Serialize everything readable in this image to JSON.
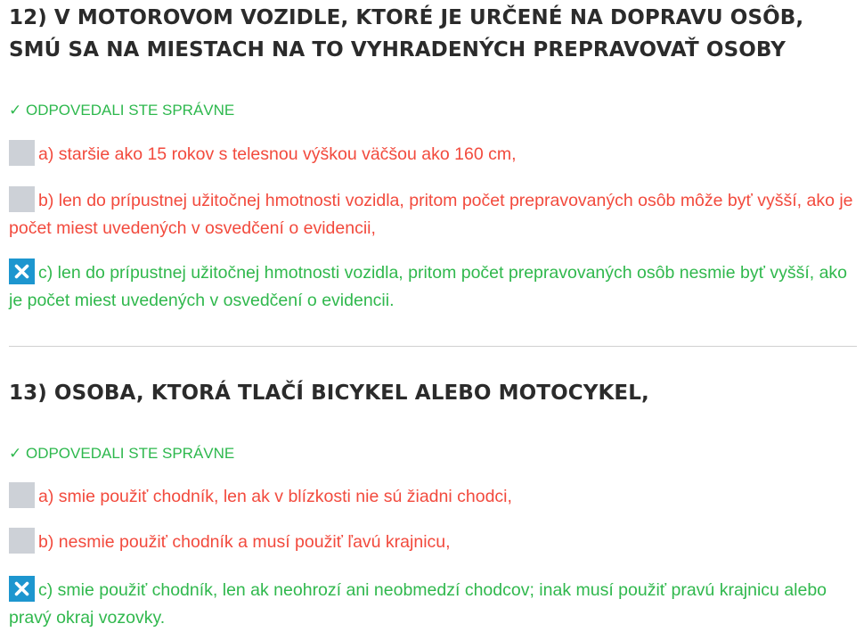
{
  "questions": [
    {
      "title": "12) V MOTOROVOM VOZIDLE, KTORÉ JE URČENÉ NA DOPRAVU OSÔB, SMÚ SA NA MIESTACH NA TO VYHRADENÝCH PREPRAVOVAŤ OSOBY",
      "result": "✓ ODPOVEDALI STE SPRÁVNE",
      "answers": [
        {
          "text": "a) staršie ako 15 rokov s telesnou výškou väčšou ako 160 cm,",
          "checked": false,
          "correct": false
        },
        {
          "text": "b) len do prípustnej užitočnej hmotnosti vozidla, pritom počet prepravovaných osôb môže byť vyšší, ako je počet miest uvedených v osvedčení o evidencii,",
          "checked": false,
          "correct": false
        },
        {
          "text": "c) len do prípustnej užitočnej hmotnosti vozidla, pritom počet prepravovaných osôb nesmie byť vyšší, ako je počet miest uvedených v osvedčení o evidencii.",
          "checked": true,
          "correct": true
        }
      ]
    },
    {
      "title": "13) OSOBA, KTORÁ TLAČÍ BICYKEL ALEBO MOTOCYKEL,",
      "result": "✓ ODPOVEDALI STE SPRÁVNE",
      "answers": [
        {
          "text": "a) smie použiť chodník, len ak v blízkosti nie sú žiadni chodci,",
          "checked": false,
          "correct": false
        },
        {
          "text": "b) nesmie použiť chodník a musí použiť ľavú krajnicu,",
          "checked": false,
          "correct": false
        },
        {
          "text": "c) smie použiť chodník, len ak neohrozí ani neobmedzí chodcov; inak musí použiť pravú krajnicu alebo pravý okraj vozovky.",
          "checked": true,
          "correct": true
        }
      ]
    }
  ],
  "colors": {
    "title": "#2b2b2b",
    "correct": "#30b84d",
    "wrong": "#f24a3d",
    "checkbox_checked": "#1d96cf",
    "checkbox_empty": "#cdd1d7",
    "divider": "#d0d0d0"
  },
  "icons": {
    "checked_box": "x-mark-icon",
    "result_mark": "check-mark"
  }
}
